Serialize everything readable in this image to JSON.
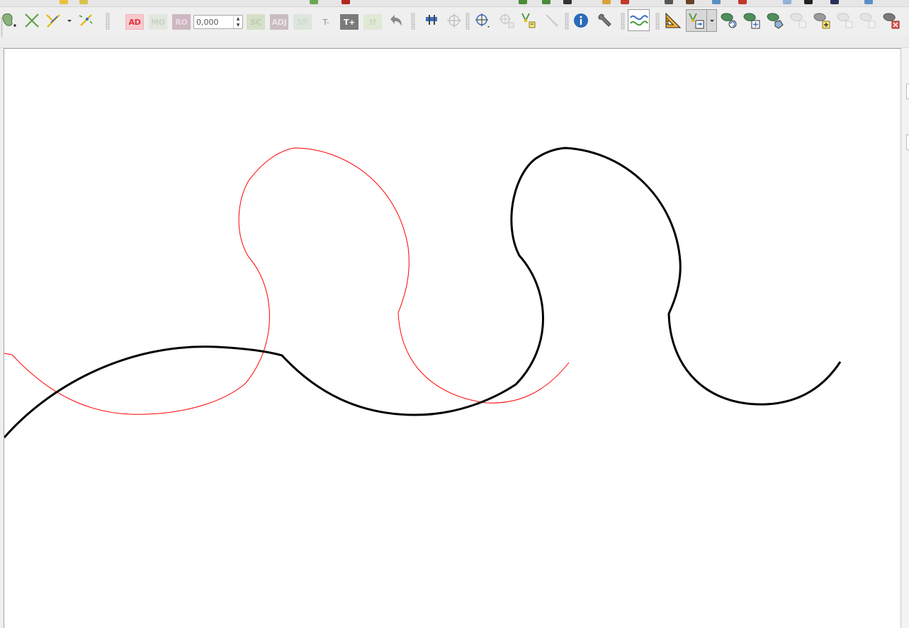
{
  "toolbar": {
    "advanced_digitizing": {
      "add_label": "AD",
      "move_label": "MO",
      "rotate_label": "RO",
      "offset_value": "0,000",
      "scale_label": "SC",
      "adjust_label": "ADJ",
      "split_label": "SP",
      "text_minus_label": "T-",
      "text_plus_label": "T+",
      "toggle_label": "!!"
    }
  },
  "colors": {
    "selected_feature": "#ff0000",
    "line_feature": "#000000",
    "canvas_background": "#ffffff",
    "toolbar_background": "#efefef"
  }
}
